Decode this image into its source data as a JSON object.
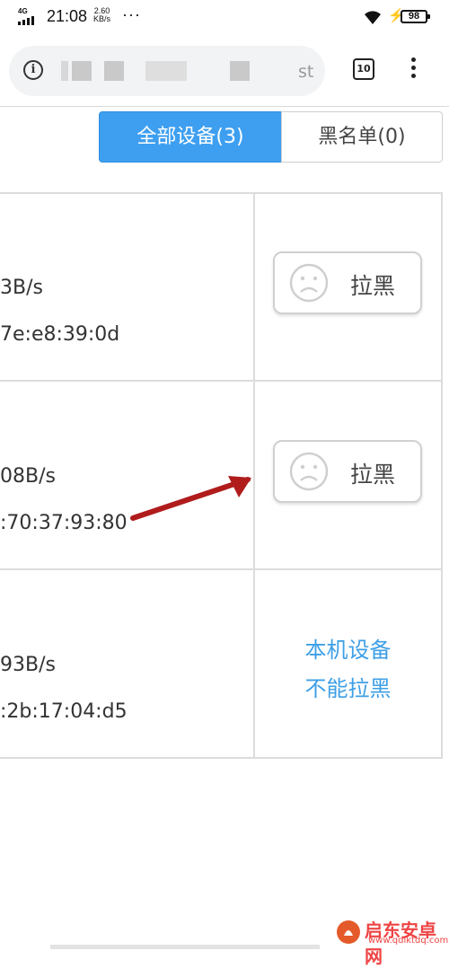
{
  "status_bar": {
    "network": "4G",
    "time": "21:08",
    "net_speed_value": "2.60",
    "net_speed_unit": "KB/s",
    "more": "···",
    "battery": "98"
  },
  "browser": {
    "url_tail": "st",
    "tab_count": "10"
  },
  "tabs": {
    "all_devices": "全部设备(3)",
    "blacklist": "黑名单(0)"
  },
  "devices": [
    {
      "speed": "3B/s",
      "mac": "7e:e8:39:0d",
      "action": "拉黑"
    },
    {
      "speed": "08B/s",
      "mac": ":70:37:93:80",
      "action": "拉黑"
    },
    {
      "speed": "93B/s",
      "mac": ":2b:17:04:d5",
      "note_line1": "本机设备",
      "note_line2": "不能拉黑"
    }
  ],
  "colors": {
    "accent": "#3e9ff0",
    "note": "#3d9fe6",
    "arrow": "#b01c1c"
  },
  "watermark": {
    "name": "启东安卓网",
    "url": "www.qdlktdq.com"
  }
}
